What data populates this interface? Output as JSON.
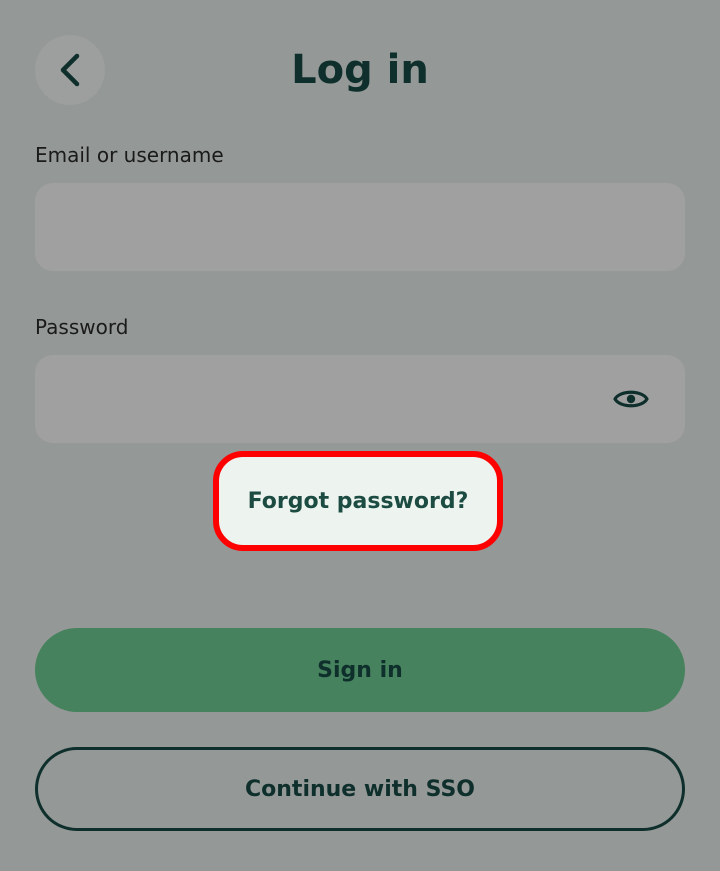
{
  "header": {
    "title": "Log in",
    "back_icon": "chevron-left-icon"
  },
  "form": {
    "email": {
      "label": "Email or username",
      "value": "",
      "placeholder": ""
    },
    "password": {
      "label": "Password",
      "value": "",
      "placeholder": "",
      "toggle_icon": "eye-icon"
    },
    "forgot_password_label": "Forgot password?"
  },
  "actions": {
    "sign_in_label": "Sign in",
    "sso_label": "Continue with SSO"
  },
  "colors": {
    "overlay_background": "#949896",
    "primary_button": "#46825d",
    "text_dark": "#0e2f2b",
    "highlight_border": "#ff0000",
    "forgot_background": "#edf3ef"
  }
}
